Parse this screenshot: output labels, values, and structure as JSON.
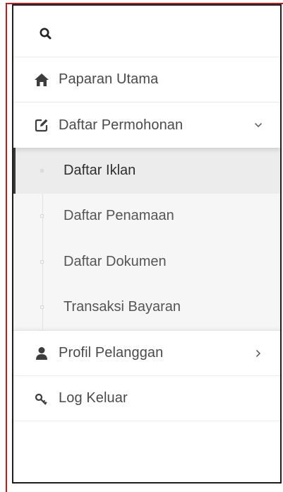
{
  "search": {
    "icon": "search-icon"
  },
  "menu": {
    "items": [
      {
        "label": "Paparan Utama",
        "icon": "home-icon"
      },
      {
        "label": "Daftar Permohonan",
        "icon": "edit-icon",
        "expanded": true
      },
      {
        "label": "Profil Pelanggan",
        "icon": "user-icon"
      },
      {
        "label": "Log Keluar",
        "icon": "key-icon"
      }
    ],
    "submenu": [
      {
        "label": "Daftar Iklan",
        "active": true
      },
      {
        "label": "Daftar Penamaan",
        "active": false
      },
      {
        "label": "Daftar Dokumen",
        "active": false
      },
      {
        "label": "Transaksi Bayaran",
        "active": false
      }
    ]
  },
  "colors": {
    "frame": "#b81c22",
    "text": "#4a4a4a",
    "icon": "#3d3d3d",
    "active_bar": "#3a3a3a"
  }
}
